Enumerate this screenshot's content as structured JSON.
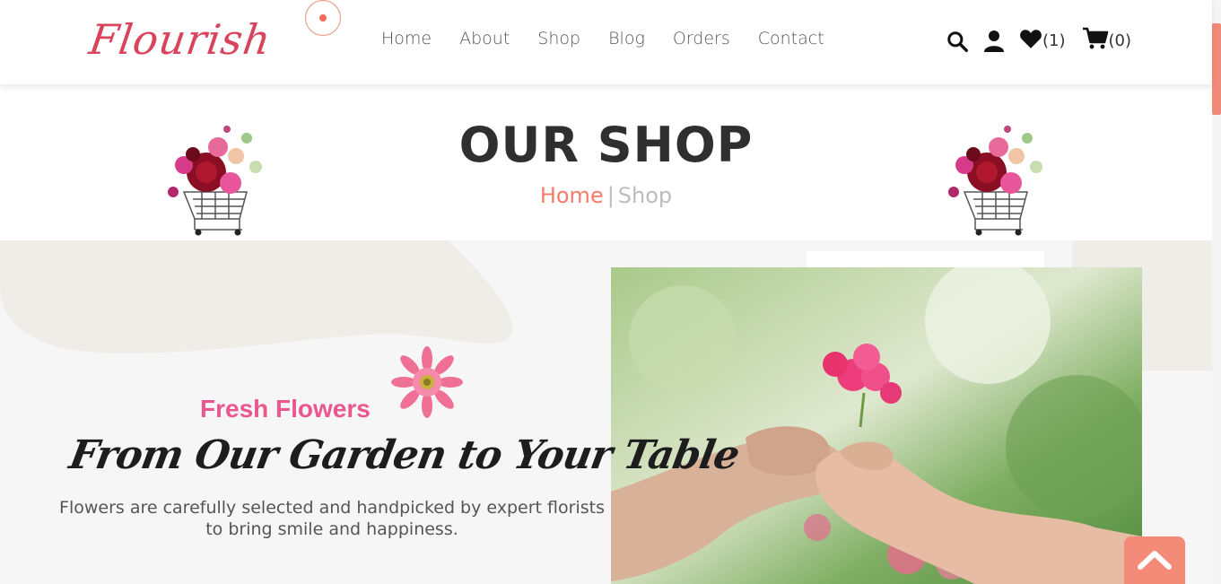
{
  "brand": {
    "logo_text": "Flourish",
    "accent": "#f47c68",
    "pink": "#e9578c"
  },
  "nav": {
    "items": [
      {
        "label": "Home"
      },
      {
        "label": "About"
      },
      {
        "label": "Shop"
      },
      {
        "label": "Blog"
      },
      {
        "label": "Orders"
      },
      {
        "label": "Contact"
      }
    ]
  },
  "header_icons": {
    "search": "search-icon",
    "user": "user-icon",
    "wishlist": "heart-icon",
    "wishlist_count": "(1)",
    "cart": "cart-icon",
    "cart_count": "(0)"
  },
  "banner": {
    "title": "OUR SHOP",
    "breadcrumb_home": "Home",
    "breadcrumb_sep": "|",
    "breadcrumb_current": "Shop"
  },
  "hero": {
    "eyebrow": "Fresh Flowers",
    "tagline": "From Our Garden to Your Table",
    "description": "Flowers are carefully selected and handpicked by expert florists to bring smile and happiness."
  },
  "back_to_top": "chevron-up-icon"
}
